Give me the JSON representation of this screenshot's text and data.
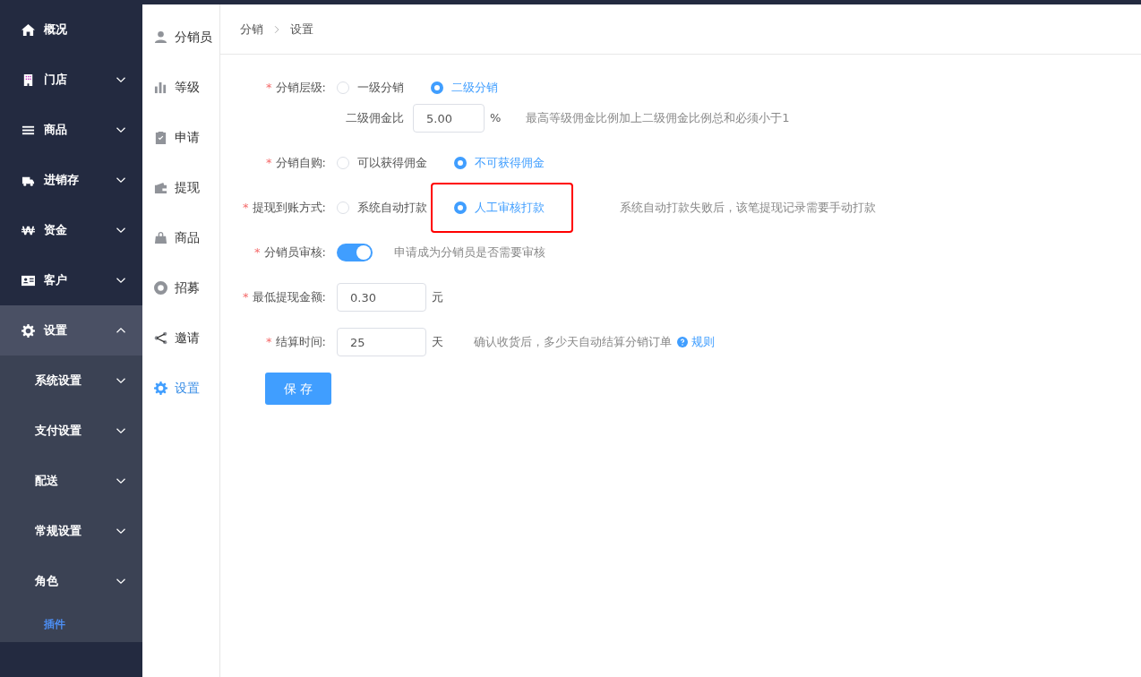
{
  "sidebar": {
    "items": [
      {
        "label": "概况",
        "kind": "home",
        "expanded": false
      },
      {
        "label": "门店",
        "kind": "building",
        "expanded": false
      },
      {
        "label": "商品",
        "kind": "bars",
        "expanded": false
      },
      {
        "label": "进销存",
        "kind": "truck",
        "expanded": false
      },
      {
        "label": "资金",
        "kind": "won",
        "expanded": false
      },
      {
        "label": "客户",
        "kind": "card",
        "expanded": false
      },
      {
        "label": "设置",
        "kind": "gear",
        "expanded": true,
        "children": [
          {
            "label": "系统设置",
            "kind": "group",
            "selected": false
          },
          {
            "label": "支付设置",
            "kind": "group",
            "selected": false
          },
          {
            "label": "配送",
            "kind": "group",
            "selected": false
          },
          {
            "label": "常规设置",
            "kind": "group",
            "selected": false
          },
          {
            "label": "角色",
            "kind": "group",
            "selected": false
          },
          {
            "label": "插件",
            "kind": "link",
            "selected": true
          }
        ]
      }
    ]
  },
  "subnav": {
    "items": [
      {
        "label": "分销员",
        "kind": "user",
        "selected": false
      },
      {
        "label": "等级",
        "kind": "chart",
        "selected": false
      },
      {
        "label": "申请",
        "kind": "clipboard",
        "selected": false
      },
      {
        "label": "提现",
        "kind": "wallet",
        "selected": false
      },
      {
        "label": "商品",
        "kind": "bag",
        "selected": false
      },
      {
        "label": "招募",
        "kind": "lifebuoy",
        "selected": false
      },
      {
        "label": "邀请",
        "kind": "share",
        "selected": false
      },
      {
        "label": "设置",
        "kind": "gear",
        "selected": true
      }
    ]
  },
  "breadcrumb": [
    "分销",
    "设置"
  ],
  "form": {
    "rows": [
      {
        "kind": "radio",
        "label": "分销层级:",
        "marker": "*",
        "options": [
          {
            "label": "一级分销",
            "selected": false,
            "highlighted": false
          },
          {
            "label": "二级分销",
            "selected": true,
            "highlighted": false
          }
        ],
        "sub": {
          "label": "二级佣金比",
          "value": "5.00",
          "unit": "%",
          "hint": "最高等级佣金比例加上二级佣金比例总和必须小于1"
        }
      },
      {
        "kind": "radio",
        "label": "分销自购:",
        "marker": "*",
        "options": [
          {
            "label": "可以获得佣金",
            "selected": false,
            "highlighted": false
          },
          {
            "label": "不可获得佣金",
            "selected": true,
            "highlighted": false
          }
        ]
      },
      {
        "kind": "radio",
        "label": "提现到账方式:",
        "marker": "*",
        "options": [
          {
            "label": "系统自动打款",
            "selected": false,
            "highlighted": false
          },
          {
            "label": "人工审核打款",
            "selected": true,
            "highlighted": true
          }
        ],
        "hint": "系统自动打款失败后，该笔提现记录需要手动打款"
      },
      {
        "kind": "toggle",
        "label": "分销员审核:",
        "marker": "*",
        "on": true,
        "hint": "申请成为分销员是否需要审核"
      },
      {
        "kind": "input",
        "label": "最低提现金额:",
        "marker": "*",
        "value": "0.30",
        "unit": "元"
      },
      {
        "kind": "input",
        "label": "结算时间:",
        "marker": "*",
        "value": "25",
        "unit": "天",
        "hint": "确认收货后，多少天自动结算分销订单",
        "link": "规则"
      }
    ],
    "save": "保 存"
  }
}
